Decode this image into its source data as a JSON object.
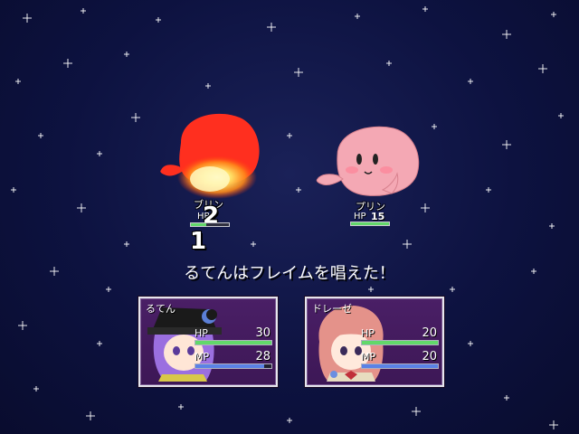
{
  "battle": {
    "message": "るてんはフレイムを唱えた！"
  },
  "enemies": [
    {
      "name": "ブリン",
      "hp_label": "HP",
      "hp_value": "2",
      "hp_fraction": 0.4,
      "body_color": "#ff2f1f",
      "state": "burning"
    },
    {
      "name": "プリン",
      "hp_label": "HP",
      "hp_value": "15",
      "hp_fraction": 1.0,
      "body_color": "#f4a8b4",
      "state": "normal"
    }
  ],
  "damage_popup": {
    "digit_1": "1"
  },
  "party": [
    {
      "name": "るてん",
      "hp_label": "HP",
      "hp": "30",
      "hp_fraction": 1.0,
      "mp_label": "MP",
      "mp": "28",
      "mp_fraction": 0.9,
      "hair_color": "#9b6fe0"
    },
    {
      "name": "ドレーゼ",
      "hp_label": "HP",
      "hp": "20",
      "hp_fraction": 1.0,
      "mp_label": "MP",
      "mp": "20",
      "mp_fraction": 1.0,
      "hair_color": "#e4928a"
    }
  ],
  "colors": {
    "background": "#0d1240",
    "window": "#4a1f66",
    "hp_gauge": "#62d86a",
    "mp_gauge": "#5a82e6"
  }
}
